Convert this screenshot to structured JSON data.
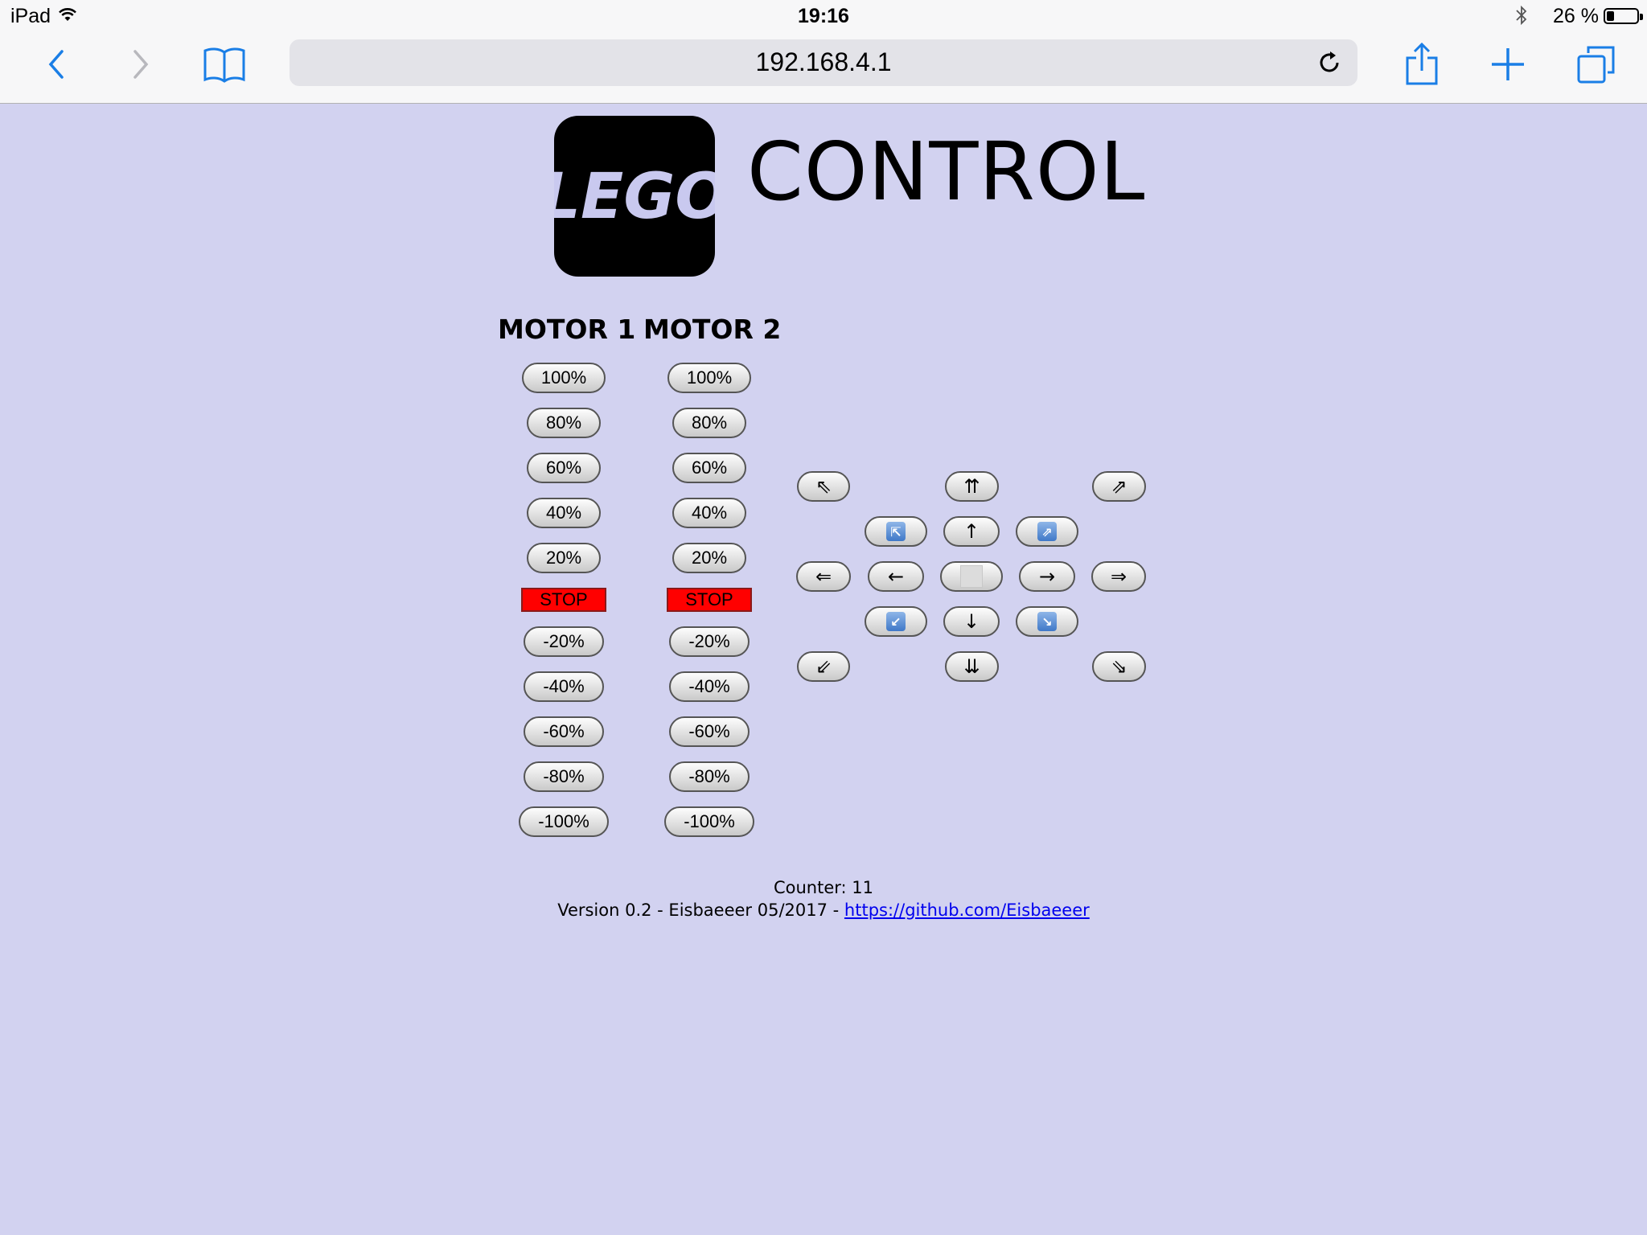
{
  "status_bar": {
    "device": "iPad",
    "time": "19:16",
    "battery": "26 %",
    "battery_level": 0.26
  },
  "browser": {
    "url": "192.168.4.1"
  },
  "page": {
    "logo_text": "LEGO",
    "title": "CONTROL"
  },
  "motor1": {
    "title": "MOTOR 1",
    "buttons": {
      "p100": "100%",
      "p80": "80%",
      "p60": "60%",
      "p40": "40%",
      "p20": "20%",
      "stop": "STOP",
      "m20": "-20%",
      "m40": "-40%",
      "m60": "-60%",
      "m80": "-80%",
      "m100": "-100%"
    }
  },
  "motor2": {
    "title": "MOTOR 2",
    "buttons": {
      "p100": "100%",
      "p80": "80%",
      "p60": "60%",
      "p40": "40%",
      "p20": "20%",
      "stop": "STOP",
      "m20": "-20%",
      "m40": "-40%",
      "m60": "-60%",
      "m80": "-80%",
      "m100": "-100%"
    }
  },
  "direction_pad": {
    "fast_up_left": "⇖",
    "fast_up": "⇈",
    "fast_up_right": "⇗",
    "up_left": "⇱",
    "up": "↑",
    "up_right": "⇗",
    "fast_left": "⇐",
    "left": "←",
    "stop": "",
    "right": "→",
    "fast_right": "⇒",
    "down_left": "↙",
    "down": "↓",
    "down_right": "↘",
    "fast_down_left": "⇙",
    "fast_down": "⇊",
    "fast_down_right": "⇘"
  },
  "footer": {
    "counter_label": "Counter:",
    "counter_value": "11",
    "version_text": "Version 0.2 - Eisbaeeer 05/2017 -",
    "link_text": "https://github.com/Eisbaeeer"
  }
}
